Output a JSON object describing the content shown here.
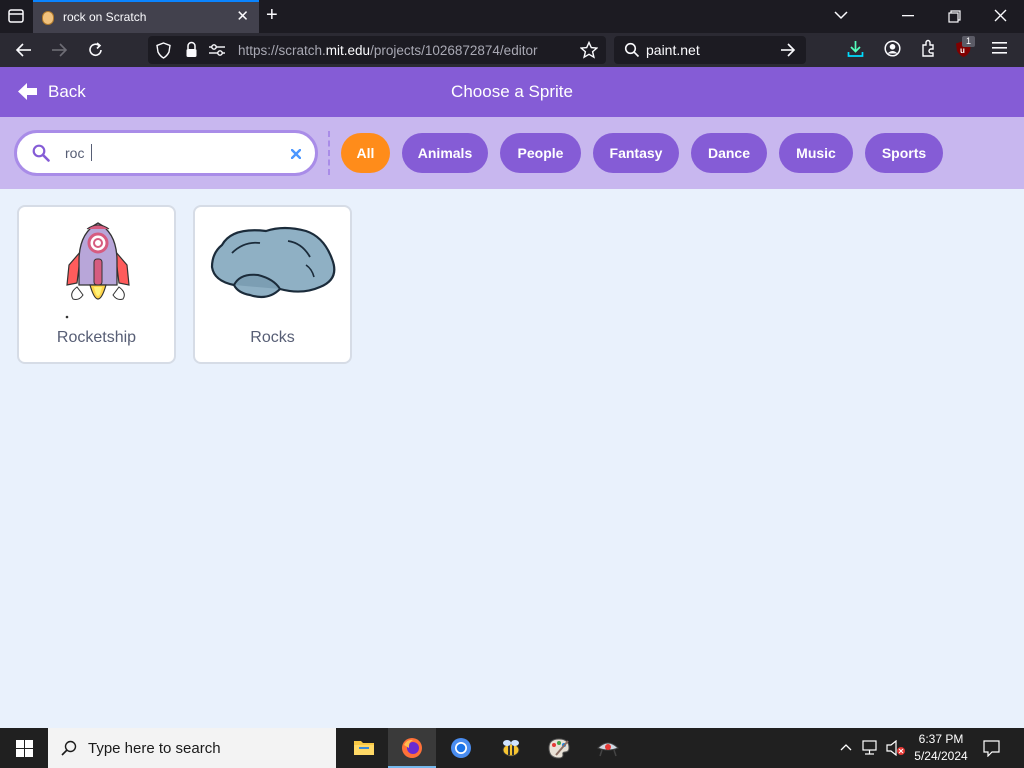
{
  "browser": {
    "tab_title": "rock on Scratch",
    "tab_close": "✕",
    "new_tab": "+",
    "url_prefix": "https://scratch.",
    "url_domain": "mit.edu",
    "url_path": "/projects/1026872874/editor",
    "search_value": "paint.net",
    "extension_badge": "1"
  },
  "header": {
    "back_label": "Back",
    "title": "Choose a Sprite"
  },
  "search": {
    "value": "roc"
  },
  "categories": [
    "All",
    "Animals",
    "People",
    "Fantasy",
    "Dance",
    "Music",
    "Sports"
  ],
  "sprites": [
    {
      "name": "Rocketship"
    },
    {
      "name": "Rocks"
    }
  ],
  "taskbar": {
    "search_placeholder": "Type here to search",
    "time": "6:37 PM",
    "date": "5/24/2024"
  },
  "colors": {
    "scratch_purple": "#855cd6",
    "filter_bg": "#c8b7ef",
    "active_pill": "#ff8c1a",
    "page_bg": "#e9f1fc"
  }
}
